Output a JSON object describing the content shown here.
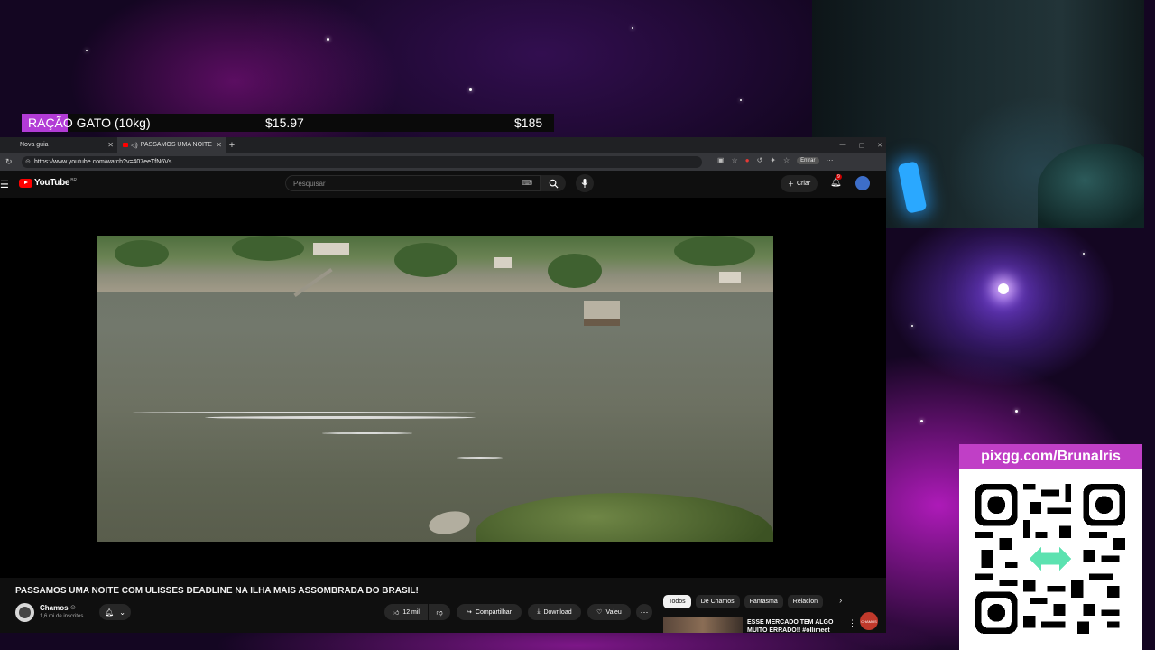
{
  "overlay": {
    "goal": {
      "label": "RAÇÃO GATO (10kg)",
      "current": "$15.97",
      "target": "$185",
      "progress": 0.086,
      "fill_color": "#b23bd6"
    },
    "pix": {
      "url": "pixgg.com/Brunalris",
      "header_color": "#c03fc6"
    }
  },
  "browser": {
    "tabs": [
      {
        "label": "Nova guia"
      },
      {
        "label": "PASSAMOS UMA NOITE"
      }
    ],
    "url": "https://www.youtube.com/watch?v=407eeTfN6Vs",
    "profile_label": "Entrar"
  },
  "youtube": {
    "logo_text": "YouTube",
    "country": "BR",
    "search_placeholder": "Pesquisar",
    "create_label": "Criar",
    "notification_count": "9",
    "video": {
      "title": "PASSAMOS UMA NOITE COM ULISSES DEADLINE NA ILHA MAIS ASSOMBRADA DO BRASIL!",
      "channel": "Chamos",
      "subscribers": "1,6 mi de inscritos",
      "watermark": "CHAMOS",
      "actions": {
        "likes": "12 mil",
        "share": "Compartilhar",
        "download": "Download",
        "thanks": "Valeu"
      }
    },
    "chips": [
      "Todos",
      "De Chamos",
      "Fantasma",
      "Relacion"
    ],
    "recommendation": {
      "title": "ESSE MERCADO TEM ALGO MUITO ERRADO!! #ollimeet"
    }
  }
}
